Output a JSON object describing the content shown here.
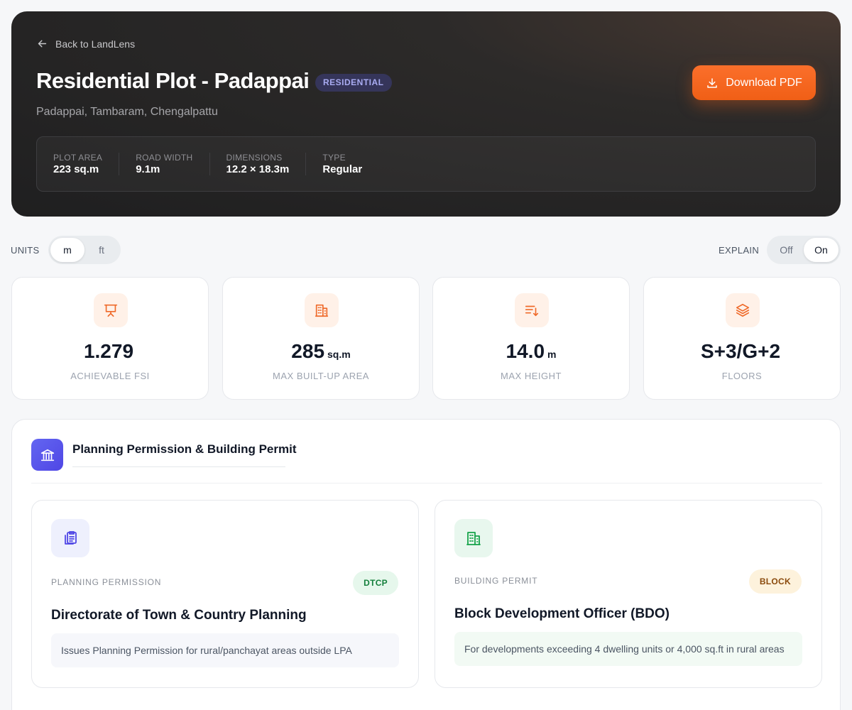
{
  "header": {
    "back_label": "Back to LandLens",
    "title": "Residential Plot - Padappai",
    "type_badge": "RESIDENTIAL",
    "location": "Padappai, Tambaram, Chengalpattu",
    "download_label": "Download PDF",
    "stats": [
      {
        "label": "PLOT AREA",
        "value": "223 sq.m"
      },
      {
        "label": "ROAD WIDTH",
        "value": "9.1m"
      },
      {
        "label": "DIMENSIONS",
        "value": "12.2 × 18.3m"
      },
      {
        "label": "TYPE",
        "value": "Regular"
      }
    ]
  },
  "controls": {
    "units_label": "UNITS",
    "units_options": [
      "m",
      "ft"
    ],
    "units_selected": "m",
    "explain_label": "EXPLAIN",
    "explain_options": [
      "Off",
      "On"
    ],
    "explain_selected": "On"
  },
  "metrics": [
    {
      "icon": "presentation-board-icon",
      "value": "1.279",
      "unit": "",
      "label": "ACHIEVABLE FSI"
    },
    {
      "icon": "building-icon",
      "value": "285",
      "unit": "sq.m",
      "label": "MAX BUILT-UP AREA"
    },
    {
      "icon": "height-sort-icon",
      "value": "14.0",
      "unit": "m",
      "label": "MAX HEIGHT"
    },
    {
      "icon": "layers-icon",
      "value": "S+3/G+2",
      "unit": "",
      "label": "FLOORS"
    }
  ],
  "permissions": {
    "title": "Planning Permission & Building Permit",
    "cards": [
      {
        "kind": "PLANNING PERMISSION",
        "badge": "DTCP",
        "authority": "Directorate of Town & Country Planning",
        "note": "Issues Planning Permission for rural/panchayat areas outside LPA"
      },
      {
        "kind": "BUILDING PERMIT",
        "badge": "BLOCK",
        "authority": "Block Development Officer (BDO)",
        "note": "For developments exceeding 4 dwelling units or 4,000 sq.ft in rural areas"
      }
    ]
  },
  "colors": {
    "accent_orange": "#f26419",
    "accent_indigo": "#5b5ef0",
    "hero_dark": "#232324",
    "success_green": "#15803d"
  }
}
